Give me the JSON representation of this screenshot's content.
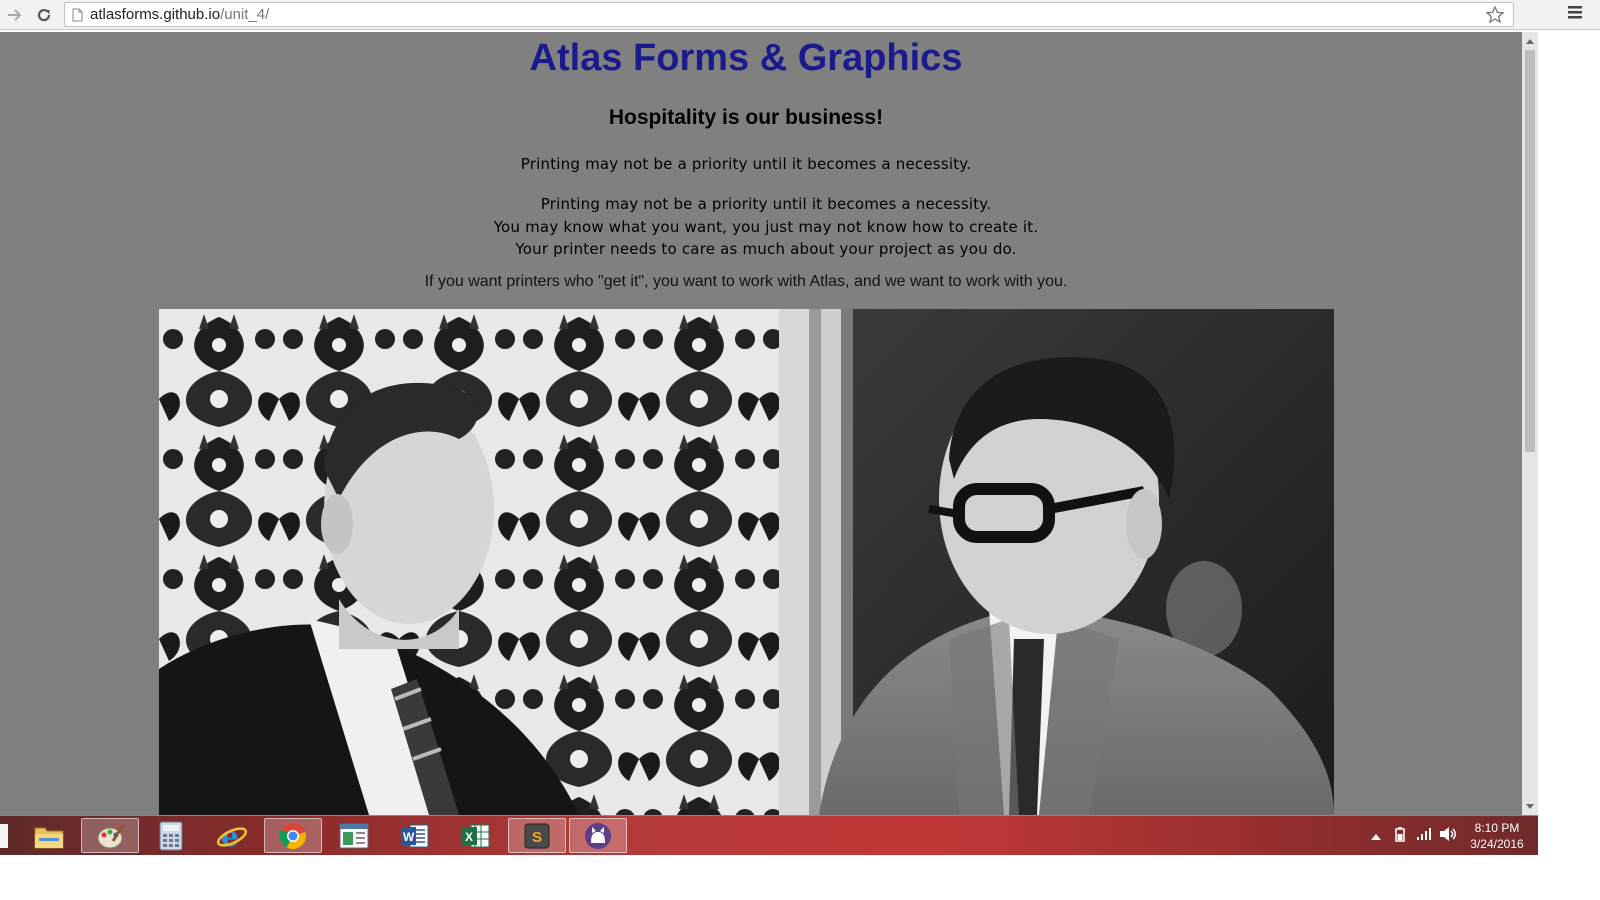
{
  "browser": {
    "url_host": "atlasforms.github.io",
    "url_path": "/unit_4/",
    "icons": {
      "forward": "forward-arrow-icon",
      "reload": "reload-icon",
      "page": "page-icon",
      "bookmark": "star-icon",
      "menu": "hamburger-menu-icon"
    }
  },
  "page": {
    "title": "Atlas Forms & Graphics",
    "tagline": "Hospitality is our business!",
    "line1": "Printing may not be a priority until it becomes a necessity.",
    "block": [
      "Printing may not be a priority until it becomes a necessity.",
      "You may know what you want, you just may not know how to create it.",
      "Your printer needs to care as much about your project as you do."
    ],
    "closing": "If you want printers who \"get it\", you want to work with Atlas, and we want to work with you.",
    "colors": {
      "background": "#808080",
      "title": "#1a1a8c"
    }
  },
  "taskbar": {
    "apps": [
      "file-explorer-icon",
      "paint-icon",
      "calculator-icon",
      "internet-explorer-icon",
      "chrome-icon",
      "document-viewer-icon",
      "word-icon",
      "excel-icon",
      "sublime-text-icon",
      "github-icon"
    ],
    "time": "8:10 PM",
    "date": "3/24/2016"
  }
}
